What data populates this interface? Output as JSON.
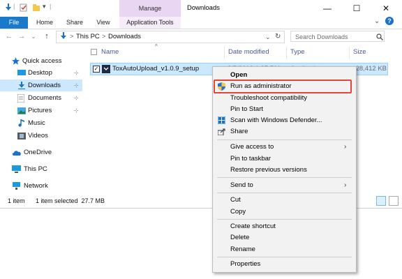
{
  "window": {
    "title": "Downloads",
    "context_group": "Manage",
    "controls": {
      "minimize": "—",
      "maximize": "☐",
      "close": "✕"
    }
  },
  "ribbon": {
    "tabs": [
      "File",
      "Home",
      "Share",
      "View",
      "Application Tools"
    ],
    "active_file_color": "#1979ca",
    "expand_glyph": "⌄",
    "help_glyph": "?"
  },
  "address": {
    "back": "←",
    "forward": "→",
    "recent": "⌄",
    "up": "↑",
    "path": [
      "This PC",
      "Downloads"
    ],
    "separator": ">",
    "dropdown": "⌄",
    "refresh": "↻",
    "search_placeholder": "Search Downloads"
  },
  "nav_pane": {
    "quick_access": "Quick access",
    "items": [
      {
        "label": "Desktop",
        "icon": "desktop-icon",
        "pinned": true
      },
      {
        "label": "Downloads",
        "icon": "downloads-icon",
        "pinned": true,
        "selected": true
      },
      {
        "label": "Documents",
        "icon": "documents-icon",
        "pinned": true
      },
      {
        "label": "Pictures",
        "icon": "pictures-icon",
        "pinned": true
      },
      {
        "label": "Music",
        "icon": "music-icon",
        "pinned": false
      },
      {
        "label": "Videos",
        "icon": "videos-icon",
        "pinned": false
      }
    ],
    "onedrive": "OneDrive",
    "this_pc": "This PC",
    "network": "Network",
    "pin_glyph": "📌"
  },
  "file_list": {
    "columns": [
      "Name",
      "Date modified",
      "Type",
      "Size"
    ],
    "sort_glyph": "^",
    "rows": [
      {
        "name": "ToxAutoUpload_v1.0.9_setup",
        "date": "3/5/2019 1:37 PM",
        "type": "Application",
        "size": "28,412 KB",
        "selected": true
      }
    ]
  },
  "status_bar": {
    "count": "1 item",
    "selection": "1 item selected  27.7 MB"
  },
  "context_menu": {
    "items": [
      {
        "label": "Open",
        "bold": true
      },
      {
        "label": "Run as administrator",
        "icon": "shield-icon",
        "highlighted": true
      },
      {
        "label": "Troubleshoot compatibility"
      },
      {
        "label": "Pin to Start"
      },
      {
        "label": "Scan with Windows Defender...",
        "icon": "defender-icon"
      },
      {
        "label": "Share",
        "icon": "share-icon"
      },
      {
        "label": "Give access to",
        "submenu": true
      },
      {
        "label": "Pin to taskbar"
      },
      {
        "label": "Restore previous versions"
      },
      {
        "label": "Send to",
        "submenu": true
      },
      {
        "label": "Cut"
      },
      {
        "label": "Copy"
      },
      {
        "label": "Create shortcut"
      },
      {
        "label": "Delete"
      },
      {
        "label": "Rename"
      },
      {
        "label": "Properties"
      }
    ],
    "submenu_glyph": "›",
    "highlight_color": "#e0463a"
  }
}
